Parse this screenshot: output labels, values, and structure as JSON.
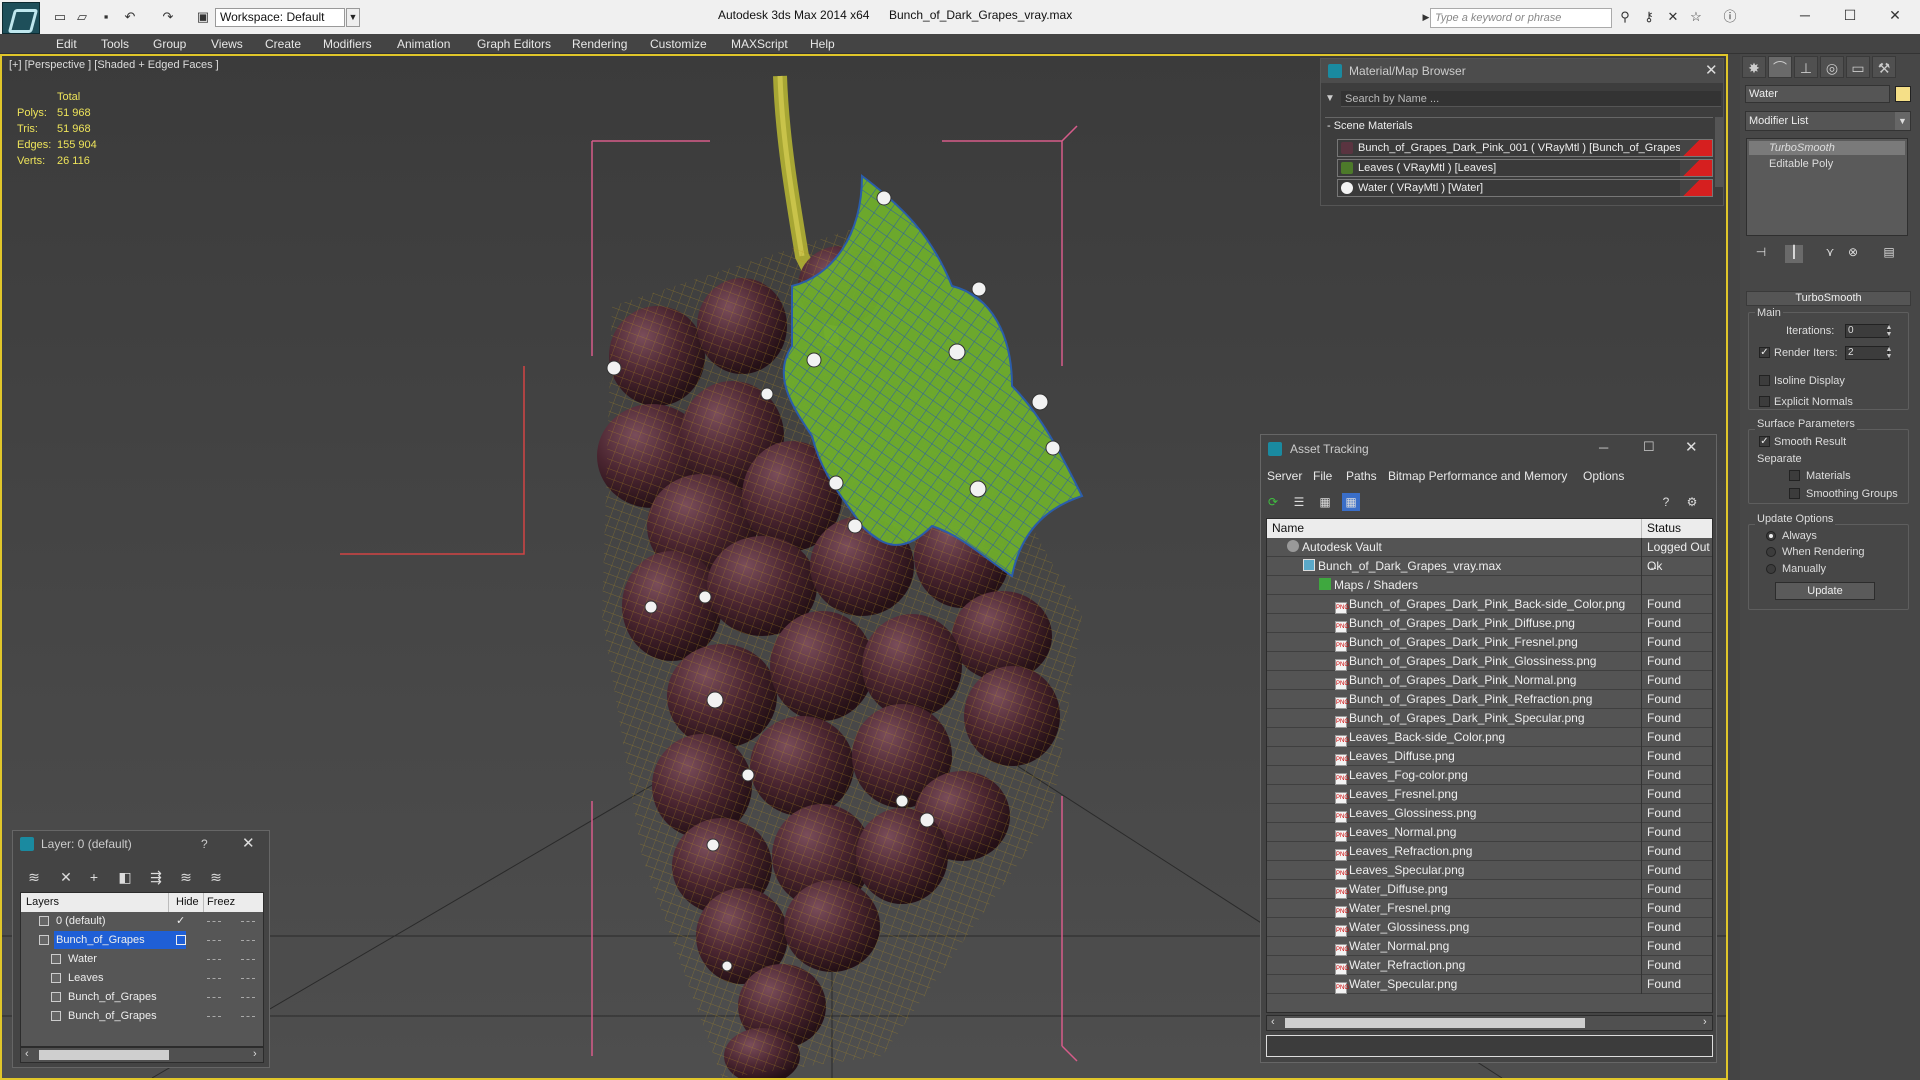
{
  "title_bar": {
    "workspace": "Workspace: Default",
    "app_title": "Autodesk 3ds Max  2014 x64",
    "file_title": "Bunch_of_Dark_Grapes_vray.max",
    "search_placeholder": "Type a keyword or phrase"
  },
  "menu": [
    "Edit",
    "Tools",
    "Group",
    "Views",
    "Create",
    "Modifiers",
    "Animation",
    "Graph Editors",
    "Rendering",
    "Customize",
    "MAXScript",
    "Help"
  ],
  "viewport": {
    "label": "[+] [Perspective ] [Shaded + Edged Faces ]",
    "stats": {
      "total_label": "Total",
      "rows": [
        {
          "label": "Polys:",
          "value": "51 968"
        },
        {
          "label": "Tris:",
          "value": "51 968"
        },
        {
          "label": "Edges:",
          "value": "155 904"
        },
        {
          "label": "Verts:",
          "value": "26 116"
        }
      ]
    }
  },
  "material_browser": {
    "title": "Material/Map Browser",
    "search_placeholder": "Search by Name ...",
    "section": "- Scene Materials",
    "materials": [
      {
        "label": "Bunch_of_Grapes_Dark_Pink_001  ( VRayMtl ) [Bunch_of_Grapes]",
        "swatch": "#5a3440"
      },
      {
        "label": "Leaves  ( VRayMtl ) [Leaves]",
        "swatch": "#4d7a2a"
      },
      {
        "label": "Water  ( VRayMtl ) [Water]",
        "swatch": "#f4f4f4"
      }
    ]
  },
  "command_panel": {
    "object_name": "Water",
    "modifier_list": "Modifier List",
    "stack": [
      "TurboSmooth",
      "Editable Poly"
    ],
    "turbosmooth": {
      "header": "TurboSmooth",
      "main": "Main",
      "iterations_label": "Iterations:",
      "iterations_value": "0",
      "render_iters_label": "Render Iters:",
      "render_iters_value": "2",
      "isoline": "Isoline Display",
      "explicit_normals": "Explicit Normals",
      "surface_params": "Surface Parameters",
      "smooth_result": "Smooth Result",
      "separate": "Separate",
      "materials": "Materials",
      "smoothing_groups": "Smoothing Groups",
      "update_options": "Update Options",
      "always": "Always",
      "when_rendering": "When Rendering",
      "manually": "Manually",
      "update_btn": "Update"
    }
  },
  "asset_tracking": {
    "title": "Asset Tracking",
    "menu": [
      "Server",
      "File",
      "Paths",
      "Bitmap Performance and Memory",
      "Options"
    ],
    "col_name": "Name",
    "col_status": "Status",
    "rows": [
      {
        "name": "Autodesk Vault",
        "status": "Logged Out ...",
        "level": 1,
        "kind": "vault"
      },
      {
        "name": "Bunch_of_Dark_Grapes_vray.max",
        "status": "Ok",
        "level": 2,
        "kind": "max"
      },
      {
        "name": "Maps / Shaders",
        "status": "",
        "level": 3,
        "kind": "folder"
      },
      {
        "name": "Bunch_of_Grapes_Dark_Pink_Back-side_Color.png",
        "status": "Found",
        "level": 4,
        "kind": "png"
      },
      {
        "name": "Bunch_of_Grapes_Dark_Pink_Diffuse.png",
        "status": "Found",
        "level": 4,
        "kind": "png"
      },
      {
        "name": "Bunch_of_Grapes_Dark_Pink_Fresnel.png",
        "status": "Found",
        "level": 4,
        "kind": "png"
      },
      {
        "name": "Bunch_of_Grapes_Dark_Pink_Glossiness.png",
        "status": "Found",
        "level": 4,
        "kind": "png"
      },
      {
        "name": "Bunch_of_Grapes_Dark_Pink_Normal.png",
        "status": "Found",
        "level": 4,
        "kind": "png"
      },
      {
        "name": "Bunch_of_Grapes_Dark_Pink_Refraction.png",
        "status": "Found",
        "level": 4,
        "kind": "png"
      },
      {
        "name": "Bunch_of_Grapes_Dark_Pink_Specular.png",
        "status": "Found",
        "level": 4,
        "kind": "png"
      },
      {
        "name": "Leaves_Back-side_Color.png",
        "status": "Found",
        "level": 4,
        "kind": "png"
      },
      {
        "name": "Leaves_Diffuse.png",
        "status": "Found",
        "level": 4,
        "kind": "png"
      },
      {
        "name": "Leaves_Fog-color.png",
        "status": "Found",
        "level": 4,
        "kind": "png"
      },
      {
        "name": "Leaves_Fresnel.png",
        "status": "Found",
        "level": 4,
        "kind": "png"
      },
      {
        "name": "Leaves_Glossiness.png",
        "status": "Found",
        "level": 4,
        "kind": "png"
      },
      {
        "name": "Leaves_Normal.png",
        "status": "Found",
        "level": 4,
        "kind": "png"
      },
      {
        "name": "Leaves_Refraction.png",
        "status": "Found",
        "level": 4,
        "kind": "png"
      },
      {
        "name": "Leaves_Specular.png",
        "status": "Found",
        "level": 4,
        "kind": "png"
      },
      {
        "name": "Water_Diffuse.png",
        "status": "Found",
        "level": 4,
        "kind": "png"
      },
      {
        "name": "Water_Fresnel.png",
        "status": "Found",
        "level": 4,
        "kind": "png"
      },
      {
        "name": "Water_Glossiness.png",
        "status": "Found",
        "level": 4,
        "kind": "png"
      },
      {
        "name": "Water_Normal.png",
        "status": "Found",
        "level": 4,
        "kind": "png"
      },
      {
        "name": "Water_Refraction.png",
        "status": "Found",
        "level": 4,
        "kind": "png"
      },
      {
        "name": "Water_Specular.png",
        "status": "Found",
        "level": 4,
        "kind": "png"
      }
    ]
  },
  "layer_explorer": {
    "title": "Layer: 0 (default)",
    "help": "?",
    "col_layers": "Layers",
    "col_hide": "Hide",
    "col_freeze": "Freez",
    "rows": [
      {
        "name": "0 (default)",
        "level": 1,
        "selected": false,
        "check": true
      },
      {
        "name": "Bunch_of_Grapes",
        "level": 1,
        "selected": true,
        "check": false
      },
      {
        "name": "Water",
        "level": 2,
        "selected": false,
        "check": false
      },
      {
        "name": "Leaves",
        "level": 2,
        "selected": false,
        "check": false
      },
      {
        "name": "Bunch_of_Grapes",
        "level": 2,
        "selected": false,
        "check": false
      },
      {
        "name": "Bunch_of_Grapes",
        "level": 2,
        "selected": false,
        "check": false
      }
    ]
  },
  "colors": {
    "viewport_border": "#e0c62a",
    "stat_text": "#ede35a",
    "selection_blue": "#1f5fd6"
  }
}
